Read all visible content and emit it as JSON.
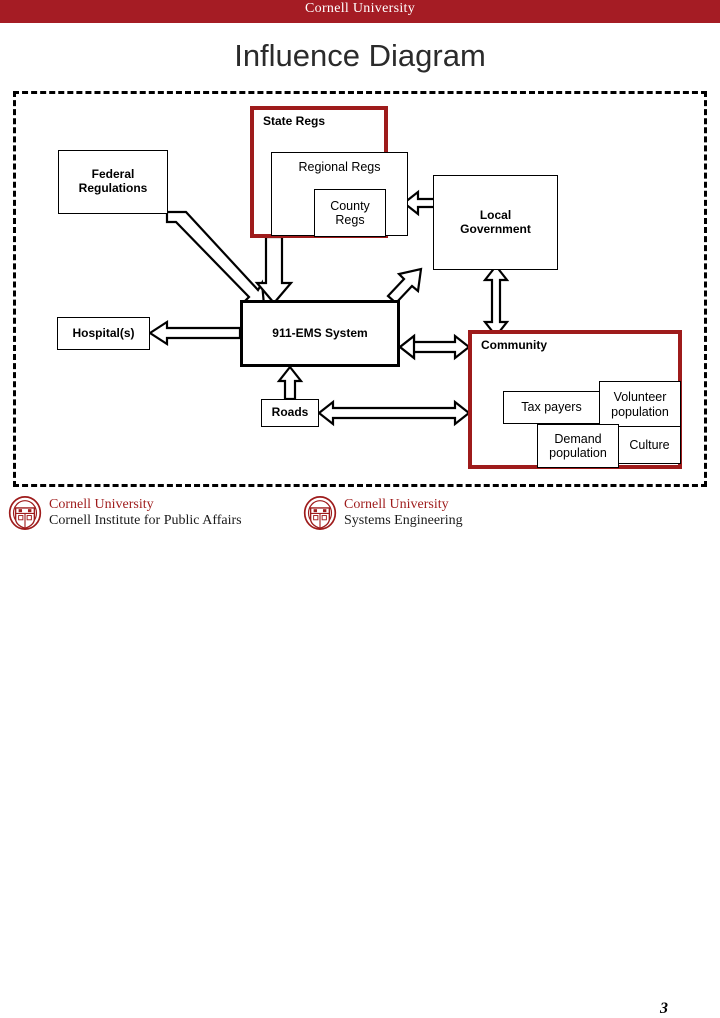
{
  "banner": {
    "institution": "Cornell University"
  },
  "slide": {
    "title": "Influence Diagram",
    "number": "3"
  },
  "diagram": {
    "nodes": {
      "federal_regulations": "Federal\nRegulations",
      "federal_regulations_line1": "Federal",
      "federal_regulations_line2": "Regulations",
      "state_regs": "State Regs",
      "regional_regs": "Regional Regs",
      "county_regs_line1": "County",
      "county_regs_line2": "Regs",
      "local_government_line1": "Local",
      "local_government_line2": "Government",
      "hospitals": "Hospital(s)",
      "ems_system": "911-EMS System",
      "roads": "Roads",
      "community": "Community",
      "tax_payers": "Tax payers",
      "volunteer_population_line1": "Volunteer",
      "volunteer_population_line2": "population",
      "demand_population_line1": "Demand",
      "demand_population_line2": "population",
      "culture": "Culture"
    },
    "edges": [
      {
        "from": "federal_regulations",
        "to": "ems_system",
        "style": "single-arrow-diagonal"
      },
      {
        "from": "state_regs",
        "to": "ems_system",
        "style": "single-arrow-down"
      },
      {
        "from": "state_regs",
        "to": "local_government",
        "style": "double-arrow-horizontal"
      },
      {
        "from": "ems_system",
        "to": "local_government",
        "style": "single-arrow-diagonal-up"
      },
      {
        "from": "local_government",
        "to": "community",
        "style": "double-arrow-vertical"
      },
      {
        "from": "ems_system",
        "to": "hospitals",
        "style": "single-arrow-left"
      },
      {
        "from": "ems_system",
        "to": "community",
        "style": "double-arrow-horizontal"
      },
      {
        "from": "roads",
        "to": "ems_system",
        "style": "single-arrow-up"
      },
      {
        "from": "roads",
        "to": "community",
        "style": "double-arrow-horizontal"
      },
      {
        "from": "community",
        "to": "ems_system",
        "style": "single-arrow-left"
      }
    ]
  },
  "footer": {
    "logos": [
      {
        "line1": "Cornell University",
        "line2": "Cornell Institute for Public Affairs"
      },
      {
        "line1": "Cornell University",
        "line2": "Systems Engineering"
      }
    ]
  },
  "colors": {
    "brand_red": "#a51c24",
    "box_red": "#9e1b1b",
    "title_gray": "#2b2b2b"
  }
}
